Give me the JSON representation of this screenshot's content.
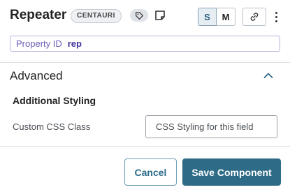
{
  "header": {
    "title": "Repeater",
    "badge": "CENTAURI",
    "tag_icon": "tag-icon",
    "note_icon": "note-icon",
    "size_options": [
      "S",
      "M"
    ],
    "selected_size": "S",
    "link_icon": "link-icon",
    "more_icon": "more-vertical-icon"
  },
  "property": {
    "label": "Property ID",
    "value": "rep"
  },
  "advanced": {
    "title": "Advanced",
    "expanded": true,
    "chevron_icon": "chevron-up-icon",
    "subsection_title": "Additional Styling",
    "css_class_label": "Custom CSS Class",
    "css_class_placeholder": "CSS Styling for this field",
    "css_class_value": ""
  },
  "footer": {
    "cancel_label": "Cancel",
    "save_label": "Save Component"
  },
  "colors": {
    "primary": "#2e6b87",
    "property_accent": "#3d3399",
    "property_border": "#b8b3de"
  }
}
